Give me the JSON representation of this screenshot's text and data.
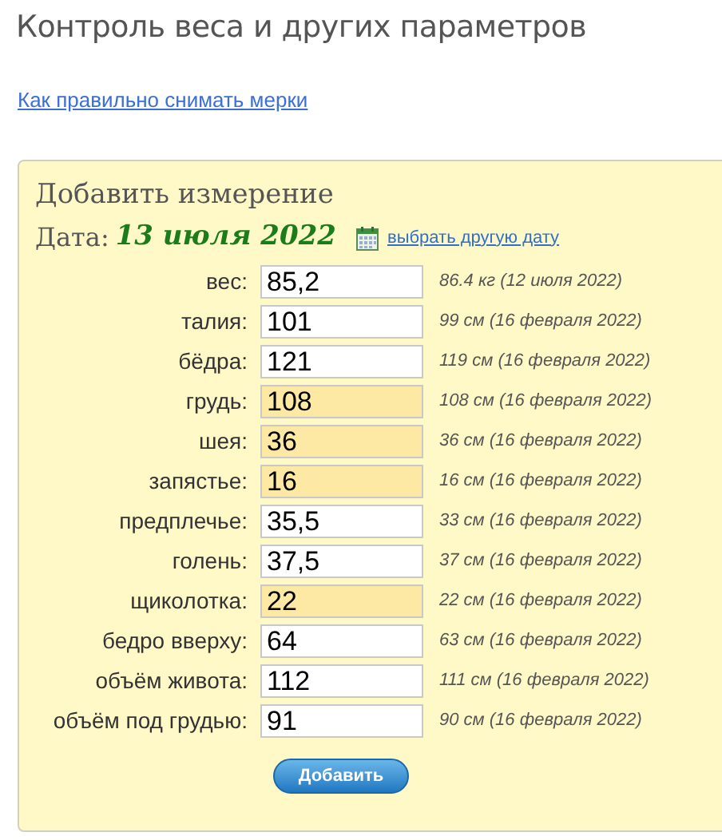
{
  "page_title": "Контроль веса и других параметров",
  "help_link": "Как правильно снимать мерки",
  "form": {
    "heading": "Добавить измерение",
    "date_label": "Дата:",
    "date_value": "13 июля 2022",
    "date_link": "выбрать другую дату",
    "rows": [
      {
        "label": "вес:",
        "value": "85,2",
        "highlighted": false,
        "previous": "86.4 кг (12 июля 2022)"
      },
      {
        "label": "талия:",
        "value": "101",
        "highlighted": false,
        "previous": "99 см (16 февраля 2022)"
      },
      {
        "label": "бёдра:",
        "value": "121",
        "highlighted": false,
        "previous": "119 см (16 февраля 2022)"
      },
      {
        "label": "грудь:",
        "value": "108",
        "highlighted": true,
        "previous": "108 см (16 февраля 2022)"
      },
      {
        "label": "шея:",
        "value": "36",
        "highlighted": true,
        "previous": "36 см (16 февраля 2022)"
      },
      {
        "label": "запястье:",
        "value": "16",
        "highlighted": true,
        "previous": "16 см (16 февраля 2022)"
      },
      {
        "label": "предплечье:",
        "value": "35,5",
        "highlighted": false,
        "previous": "33 см (16 февраля 2022)"
      },
      {
        "label": "голень:",
        "value": "37,5",
        "highlighted": false,
        "previous": "37 см (16 февраля 2022)"
      },
      {
        "label": "щиколотка:",
        "value": "22",
        "highlighted": true,
        "previous": "22 см (16 февраля 2022)"
      },
      {
        "label": "бедро вверху:",
        "value": "64",
        "highlighted": false,
        "previous": "63 см (16 февраля 2022)"
      },
      {
        "label": "объём живота:",
        "value": "112",
        "highlighted": false,
        "previous": "111 см (16 февраля 2022)"
      },
      {
        "label": "объём под грудью:",
        "value": "91",
        "highlighted": false,
        "previous": "90 см (16 февраля 2022)"
      }
    ],
    "submit": "Добавить"
  }
}
